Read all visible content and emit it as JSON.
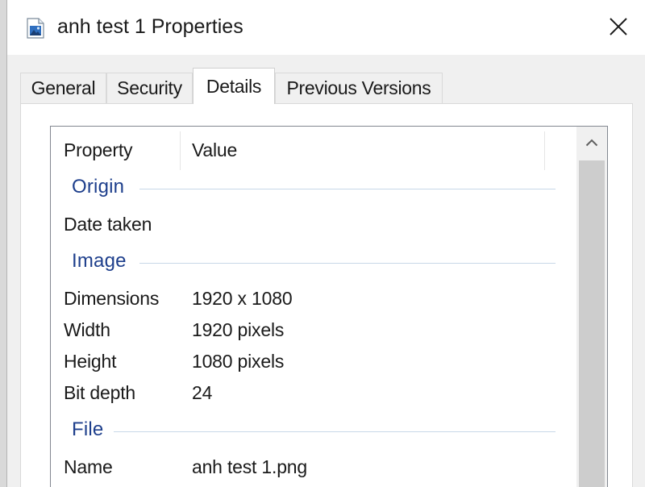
{
  "window": {
    "title": "anh test 1 Properties",
    "title_icon": "image-file-icon",
    "close_icon": "close-icon"
  },
  "tabs": [
    {
      "label": "General",
      "active": false
    },
    {
      "label": "Security",
      "active": false
    },
    {
      "label": "Details",
      "active": true
    },
    {
      "label": "Previous Versions",
      "active": false
    }
  ],
  "details": {
    "columns": {
      "property": "Property",
      "value": "Value"
    },
    "groups": [
      {
        "label": "Origin",
        "rows": [
          {
            "property": "Date taken",
            "value": ""
          }
        ]
      },
      {
        "label": "Image",
        "rows": [
          {
            "property": "Dimensions",
            "value": "1920 x 1080"
          },
          {
            "property": "Width",
            "value": "1920 pixels"
          },
          {
            "property": "Height",
            "value": "1080 pixels"
          },
          {
            "property": "Bit depth",
            "value": "24"
          }
        ]
      },
      {
        "label": "File",
        "rows": [
          {
            "property": "Name",
            "value": "anh test 1.png"
          }
        ]
      }
    ]
  },
  "colors": {
    "group_label": "#1e3f8c",
    "group_line": "#c7d7e8",
    "scroll_thumb": "#cdcdcd"
  }
}
